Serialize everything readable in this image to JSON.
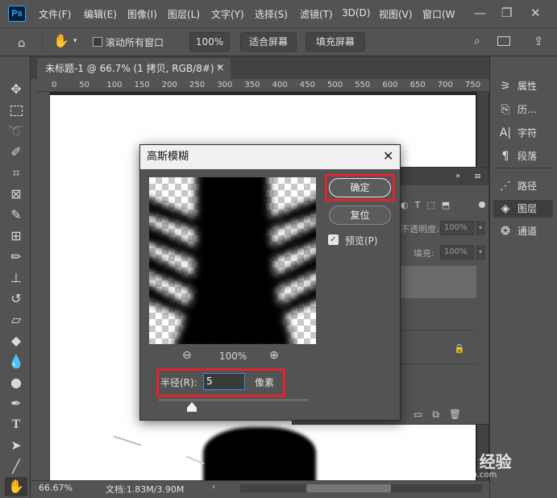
{
  "app": {
    "logo": "Ps"
  },
  "menu": [
    "文件(F)",
    "编辑(E)",
    "图像(I)",
    "图层(L)",
    "文字(Y)",
    "选择(S)",
    "滤镜(T)",
    "3D(D)",
    "视图(V)",
    "窗口(W"
  ],
  "options": {
    "scroll_all_label": "滚动所有窗口",
    "zoom_value": "100%",
    "fit_screen": "适合屏幕",
    "fill_screen": "填充屏幕"
  },
  "document": {
    "tab_title": "未标题-1 @ 66.7% (1 拷贝, RGB/8#) *",
    "close": "×"
  },
  "ruler_ticks": [
    "0",
    "50",
    "100",
    "150",
    "200",
    "250",
    "300",
    "350",
    "400",
    "450",
    "500",
    "550",
    "600",
    "650",
    "700",
    "750"
  ],
  "status": {
    "zoom": "66.67%",
    "doc_info": "文档:1.83M/3.90M"
  },
  "right_panel": {
    "group1": [
      {
        "label": "属性",
        "icon": "properties-icon",
        "glyph": "⚞"
      },
      {
        "label": "历...",
        "icon": "history-icon",
        "glyph": "⎘"
      },
      {
        "label": "字符",
        "icon": "character-icon",
        "glyph": "A|"
      },
      {
        "label": "段落",
        "icon": "paragraph-icon",
        "glyph": "¶"
      }
    ],
    "group2": [
      {
        "label": "路径",
        "icon": "paths-icon",
        "glyph": "⋰"
      },
      {
        "label": "图层",
        "icon": "layers-icon",
        "glyph": "◈"
      },
      {
        "label": "通道",
        "icon": "channels-icon",
        "glyph": "❂"
      }
    ]
  },
  "layers": {
    "opacity_label": "不透明度:",
    "opacity_value": "100%",
    "fill_label": "填充:",
    "fill_value": "100%"
  },
  "dialog": {
    "title": "高斯模糊",
    "ok_label": "确定",
    "reset_label": "复位",
    "preview_label": "预览(P)",
    "zoom_level": "100%",
    "radius_label": "半径(R):",
    "radius_value": "5",
    "radius_unit": "像素",
    "radius_slider_level": 0.1
  },
  "watermark": {
    "text": "Bai du 经验",
    "sub": "jingyan.baidu.com"
  }
}
